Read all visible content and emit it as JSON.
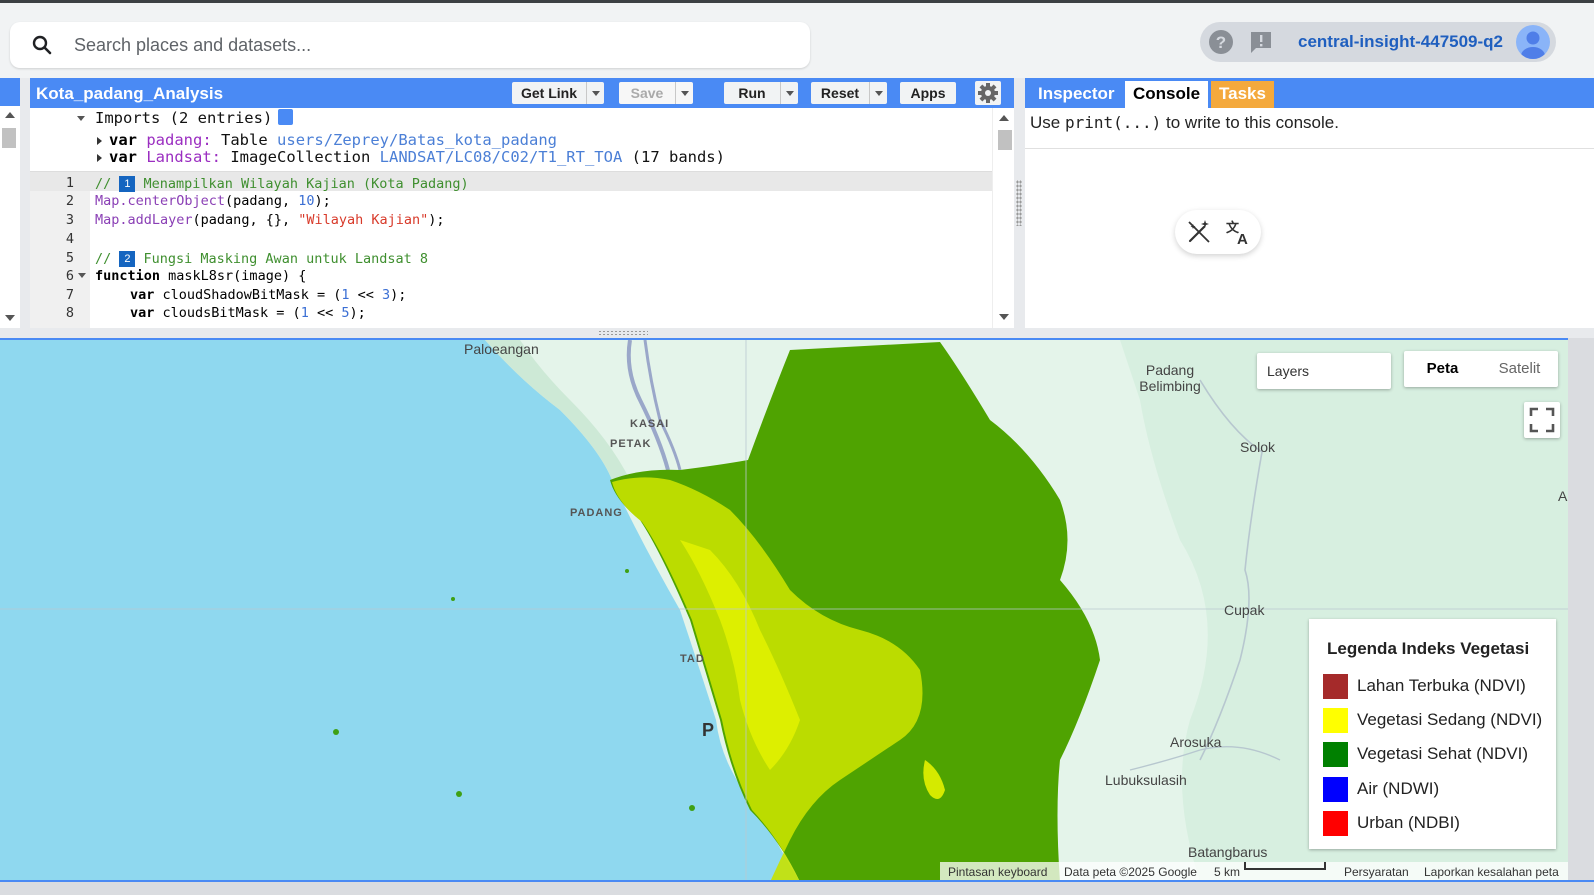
{
  "search": {
    "placeholder": "Search places and datasets..."
  },
  "account": {
    "project": "central-insight-447509-q2"
  },
  "editor": {
    "title": "Kota_padang_Analysis",
    "buttons": {
      "get_link": "Get Link",
      "save": "Save",
      "run": "Run",
      "reset": "Reset",
      "apps": "Apps"
    },
    "imports": {
      "header": "Imports (2 entries)",
      "rows": [
        {
          "kw": "var",
          "name": "padang:",
          "type": "Table",
          "path": "users/Zeprey/Batas_kota_padang",
          "extra": ""
        },
        {
          "kw": "var",
          "name": "Landsat:",
          "type": "ImageCollection",
          "path": "LANDSAT/LC08/C02/T1_RT_TOA",
          "extra": "(17 bands)"
        }
      ]
    },
    "line_numbers": [
      "1",
      "2",
      "3",
      "4",
      "5",
      "6",
      "7",
      "8"
    ],
    "lines": {
      "l1_prefix": "// ",
      "l1_badge": "1",
      "l1_text": " Menampilkan Wilayah Kajian (Kota Padang)",
      "l2_fn": "Map.centerObject",
      "l2_a": "(padang, ",
      "l2_num": "10",
      "l2_b": ");",
      "l3_fn": "Map.addLayer",
      "l3_a": "(padang, {}, ",
      "l3_str": "\"Wilayah Kajian\"",
      "l3_b": ");",
      "l5_prefix": "// ",
      "l5_badge": "2",
      "l5_text": " Fungsi Masking Awan untuk Landsat 8",
      "l6_kw": "function",
      "l6_rest": " maskL8sr(image) {",
      "l7_kw": "var",
      "l7_a": " cloudShadowBitMask = (",
      "l7_num1": "1",
      "l7_b": " << ",
      "l7_num2": "3",
      "l7_c": ");",
      "l8_kw": "var",
      "l8_a": " cloudsBitMask = (",
      "l8_num1": "1",
      "l8_b": " << ",
      "l8_num2": "5",
      "l8_c": ");"
    }
  },
  "right_panel": {
    "tabs": {
      "inspector": "Inspector",
      "console": "Console",
      "tasks": "Tasks"
    },
    "console_msg_a": "Use ",
    "console_msg_code": "print(...)",
    "console_msg_b": " to write to this console."
  },
  "map": {
    "layers_label": "Layers",
    "map_types": {
      "peta": "Peta",
      "satelit": "Satelit"
    },
    "place_labels": {
      "paloeangan": "Paloeangan",
      "padang_belimbing": "Padang\nBelimbing",
      "kasai": "KASAI",
      "petak": "PETAK",
      "solok": "Solok",
      "padang": "PADANG",
      "cupak": "Cupak",
      "tad": "TAD",
      "p": "P",
      "arosuka": "Arosuka",
      "lubuksulasih": "Lubuksulasih",
      "batangbarus": "Batangbarus",
      "a": "A"
    },
    "legend": {
      "title": "Legenda Indeks Vegetasi",
      "items": [
        {
          "label": "Lahan Terbuka (NDVI)",
          "color": "#a52a2a"
        },
        {
          "label": "Vegetasi Sedang (NDVI)",
          "color": "#ffff00"
        },
        {
          "label": "Vegetasi Sehat (NDVI)",
          "color": "#008000"
        },
        {
          "label": "Air (NDWI)",
          "color": "#0000ff"
        },
        {
          "label": "Urban (NDBI)",
          "color": "#ff0000"
        }
      ]
    },
    "attribution": {
      "shortcuts": "Pintasan keyboard",
      "data": "Data peta ©2025 Google",
      "scale": "5 km",
      "terms": "Persyaratan",
      "report": "Laporkan kesalahan peta"
    }
  },
  "colors": {
    "accent": "#4a8af4",
    "tasks": "#f4a93c",
    "water": "#8fd8ef",
    "vegetation": "#4fa301"
  }
}
